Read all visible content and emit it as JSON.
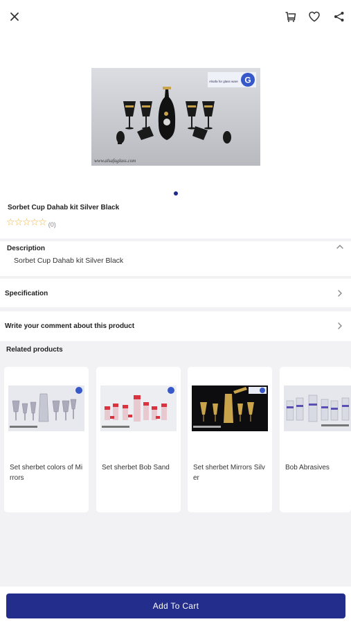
{
  "header": {
    "close_icon": "close-icon",
    "cart_icon": "cart-icon",
    "favorite_icon": "heart-icon",
    "share_icon": "share-icon"
  },
  "product": {
    "title": "Sorbet Cup Dahab kit Silver Black",
    "rating_stars": 0,
    "rating_count": "(0)",
    "image_watermark": "www.alsafaglass.com",
    "image_brand_text": "Alsafa for glass ware",
    "image_logo_letter": "G"
  },
  "gallery": {
    "pages": 1,
    "current": 1
  },
  "description": {
    "title": "Description",
    "text": "Sorbet Cup Dahab kit Silver Black",
    "expanded": true
  },
  "specification": {
    "title": "Specification"
  },
  "comment": {
    "title": "Write your comment about this product"
  },
  "related": {
    "title": "Related products",
    "items": [
      {
        "label": "Set sherbet colors of Mirrors"
      },
      {
        "label": "Set sherbet Bob Sand"
      },
      {
        "label": "Set sherbet Mirrors Silver"
      },
      {
        "label": "Bob Abrasives"
      }
    ]
  },
  "cart": {
    "label": "Add To Cart"
  },
  "colors": {
    "accent": "#232d8c",
    "star": "#f0b23b",
    "background": "#f2f2f4"
  }
}
